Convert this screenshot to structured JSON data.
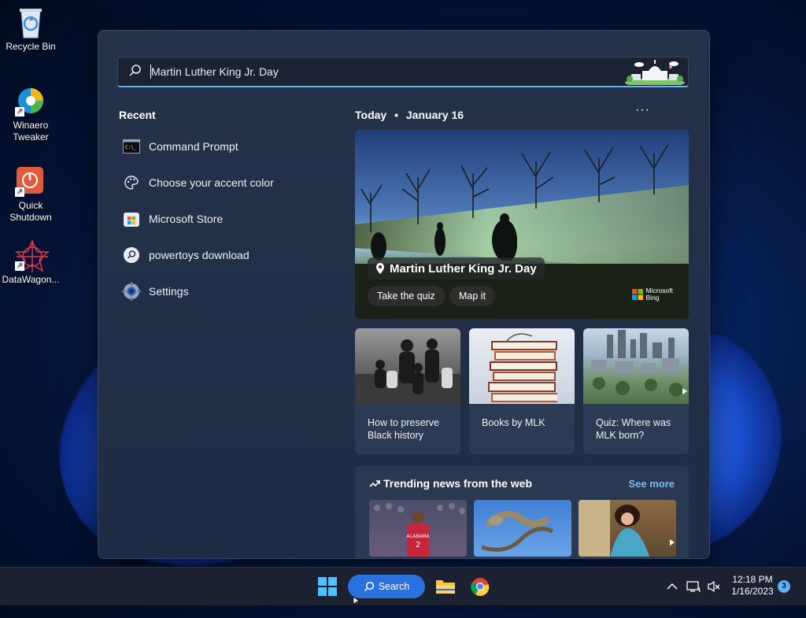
{
  "desktop": {
    "icons": [
      {
        "label": "Recycle Bin"
      },
      {
        "label": "Winaero Tweaker"
      },
      {
        "label": "Quick Shutdown"
      },
      {
        "label": "DataWagon..."
      }
    ]
  },
  "search": {
    "value": "Martin Luther King Jr. Day",
    "icon": "search-icon"
  },
  "recent": {
    "title": "Recent",
    "items": [
      {
        "label": "Command Prompt",
        "icon": "cmd-icon"
      },
      {
        "label": "Choose your accent color",
        "icon": "palette-icon"
      },
      {
        "label": "Microsoft Store",
        "icon": "store-icon"
      },
      {
        "label": "powertoys download",
        "icon": "search-icon"
      },
      {
        "label": "Settings",
        "icon": "gear-icon"
      }
    ]
  },
  "today": {
    "label": "Today",
    "date": "January 16",
    "more_icon": "more-icon"
  },
  "hero": {
    "title": "Martin Luther King Jr. Day",
    "button1": "Take the quiz",
    "button2": "Map it",
    "brand_line1": "Microsoft",
    "brand_line2": "Bing"
  },
  "cards": [
    {
      "text": "How to preserve Black history"
    },
    {
      "text": "Books by MLK"
    },
    {
      "text": "Quiz: Where was MLK born?"
    }
  ],
  "trending": {
    "title": "Trending news from the web",
    "see_more": "See more"
  },
  "taskbar": {
    "search_label": "Search",
    "time": "12:18 PM",
    "date": "1/16/2023",
    "notifications": "3"
  },
  "colors": {
    "accent": "#2a71e0",
    "panel": "#25324a",
    "link": "#7cb9f2"
  }
}
